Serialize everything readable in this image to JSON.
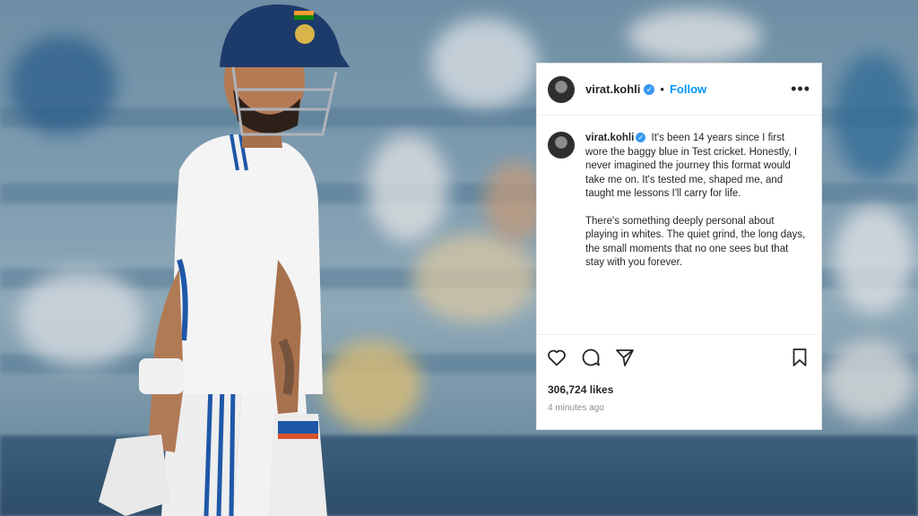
{
  "post": {
    "username": "virat.kohli",
    "verified_glyph": "✓",
    "separator": "•",
    "follow_label": "Follow",
    "more_icon": "more-options-icon",
    "caption_user": "virat.kohli",
    "caption_p1": "It's been 14 years since I first wore the baggy blue in Test cricket. Honestly, I never imagined the journey this format would take me on. It's tested me, shaped me, and taught me lessons I'll carry for life.",
    "caption_p2": "There's something deeply personal about playing in whites. The quiet grind, the long days, the small moments that no one sees but that stay with you forever.",
    "likes": "306,724 likes",
    "time": "4 minutes ago",
    "icons": [
      "heart-icon",
      "comment-icon",
      "share-icon",
      "bookmark-icon"
    ]
  },
  "colors": {
    "link_blue": "#0095f6",
    "verified_blue": "#3897f0",
    "text": "#262626",
    "muted": "#8e8e8e"
  }
}
